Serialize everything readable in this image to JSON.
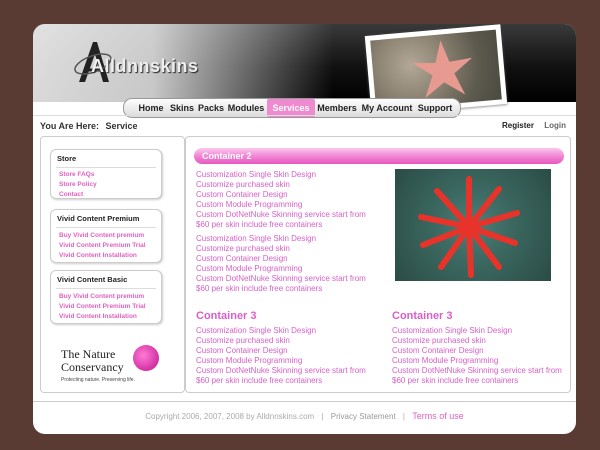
{
  "brand": {
    "logo_text": "Alldnnskins"
  },
  "nav": {
    "items": [
      {
        "label": "Home"
      },
      {
        "label": "Skins"
      },
      {
        "label": "Packs"
      },
      {
        "label": "Modules"
      },
      {
        "label": "Services"
      },
      {
        "label": "Members"
      },
      {
        "label": "My Account"
      },
      {
        "label": "Support"
      }
    ],
    "active": "Services",
    "accent_color": "#f08ad0"
  },
  "breadcrumb": {
    "label": "You Are Here:",
    "current": "Service"
  },
  "user_links": {
    "register": "Register",
    "login": "Login"
  },
  "sidebar": {
    "boxes": [
      {
        "title": "Store",
        "links": [
          "Store FAQs",
          "Store Policy",
          "Contact"
        ]
      },
      {
        "title": "Vivid Content Premium",
        "links": [
          "Buy Vivid Content premium",
          "Vivid Content Premium Trial",
          "Vivid Content Installation"
        ]
      },
      {
        "title": "Vivid Content Basic",
        "links": [
          "Buy Vivid Content premium",
          "Vivid Content Premium Trial",
          "Vivid Content Installation"
        ]
      }
    ],
    "sponsor": {
      "line1": "The Nature",
      "line2": "Conservancy",
      "tagline": "Protecting nature. Preserving life."
    }
  },
  "main": {
    "container2": {
      "title": "Container 2",
      "block1": [
        "Customization Single Skin Design",
        "Customize purchased skin",
        "Custom Container Design",
        "Custom Module Programming",
        "Custom DotNetNuke Skinning service start from",
        "$60 per skin include free containers"
      ],
      "block2": [
        "Customization Single Skin Design",
        "Customize purchased skin",
        "Custom Container Design",
        "Custom Module Programming",
        "Custom DotNetNuke Skinning service start from",
        "$60 per skin include free containers"
      ]
    },
    "container3_left": {
      "title": "Container 3",
      "lines": [
        "Customization Single Skin Design",
        "Customize purchased skin",
        "Custom Container Design",
        "Custom Module Programming",
        "Custom DotNetNuke Skinning service start from",
        "$60 per skin include free containers"
      ]
    },
    "container3_right": {
      "title": "Container 3",
      "lines": [
        "Customization Single Skin Design",
        "Customize purchased skin",
        "Custom Container Design",
        "Custom Module Programming",
        "Custom DotNetNuke Skinning service start from",
        "$60 per skin include free containers"
      ]
    }
  },
  "footer": {
    "copyright": "Copyright 2006, 2007, 2008 by Alldnnskins.com",
    "separator": "|",
    "privacy": "Privacy Statement",
    "terms": "Terms of use"
  },
  "colors": {
    "background": "#5a3b34",
    "accent": "#e060c0",
    "text_link": "#d860c8"
  }
}
